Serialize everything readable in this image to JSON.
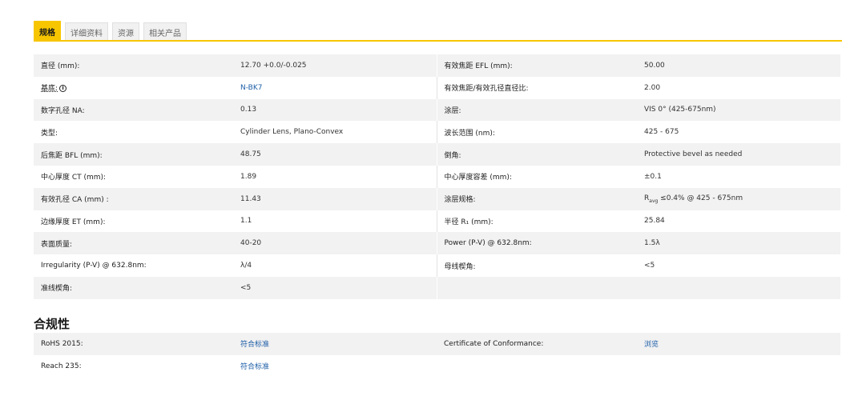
{
  "tabs": [
    "规格",
    "详细资料",
    "资源",
    "相关产品"
  ],
  "specs": [
    {
      "l1": "直径 (mm):",
      "v1": "12.70 +0.0/-0.025",
      "l2": "有效焦距 EFL (mm):",
      "v2": "50.00"
    },
    {
      "l1": "基底:",
      "v1": "N-BK7",
      "l2": "有效焦距/有效孔径直径比:",
      "v2": "2.00"
    },
    {
      "l1": "数字孔径 NA:",
      "v1": "0.13",
      "l2": "涂层:",
      "v2": "VIS 0° (425-675nm)"
    },
    {
      "l1": "类型:",
      "v1": "Cylinder Lens, Plano-Convex",
      "l2": "波长范围 (nm):",
      "v2": "425 - 675"
    },
    {
      "l1": "后焦距 BFL (mm):",
      "v1": "48.75",
      "l2": "倒角:",
      "v2": "Protective bevel as needed"
    },
    {
      "l1": "中心厚度 CT (mm):",
      "v1": "1.89",
      "l2": "中心厚度容差 (mm):",
      "v2": "±0.1"
    },
    {
      "l1": "有效孔径 CA (mm) :",
      "v1": "11.43",
      "l2": "涂层规格:",
      "v2_r": "R",
      "v2_sub": "avg",
      "v2_rest": " ≤0.4% @ 425 - 675nm"
    },
    {
      "l1": "边缘厚度 ET (mm):",
      "v1": "1.1",
      "l2": "半径 R₁ (mm):",
      "v2": "25.84"
    },
    {
      "l1": "表面质量:",
      "v1": "40-20",
      "l2": "Power (P-V) @ 632.8nm:",
      "v2": "1.5λ"
    },
    {
      "l1": "Irregularity (P-V) @ 632.8nm:",
      "v1": "λ/4",
      "l2": "母线楔角:",
      "v2": "<5"
    },
    {
      "l1": "准线楔角:",
      "v1": "<5",
      "l2": "",
      "v2": ""
    }
  ],
  "compliance": {
    "title": "合规性",
    "rows": [
      {
        "l1": "RoHS 2015:",
        "v1": "符合标准",
        "l2": "Certificate of Conformance:",
        "v2": "浏览"
      },
      {
        "l1": "Reach 235:",
        "v1": "符合标准",
        "l2": "",
        "v2": ""
      }
    ]
  },
  "colors": {
    "accent": "#f7c600",
    "link": "#1f5fa8",
    "stripe": "#f2f2f2"
  },
  "icons": {
    "substrate_info": "info-icon"
  }
}
